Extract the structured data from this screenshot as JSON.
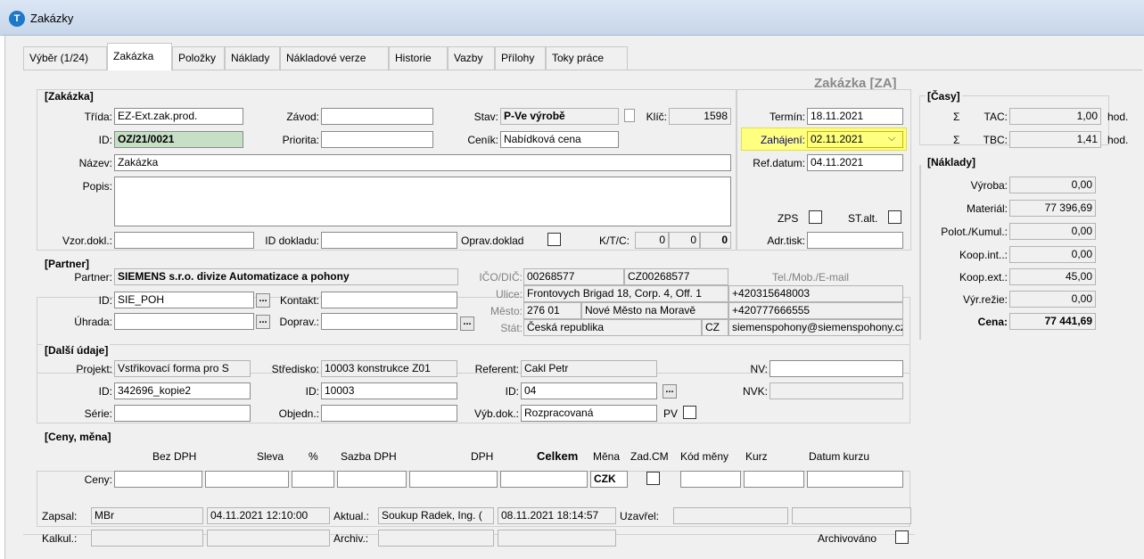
{
  "window": {
    "title": "Zakázky",
    "app_icon": "app-logo-icon"
  },
  "tabs": [
    {
      "label": "Výběr (1/24)"
    },
    {
      "label": "Zakázka"
    },
    {
      "label": "Položky"
    },
    {
      "label": "Náklady"
    },
    {
      "label": "Nákladové verze"
    },
    {
      "label": "Historie"
    },
    {
      "label": "Vazby"
    },
    {
      "label": "Přílohy"
    },
    {
      "label": "Toky práce"
    }
  ],
  "form_heading": "Zakázka [ZA]",
  "zakazka": {
    "group": "[Zakázka]",
    "trida_label": "Třída:",
    "trida": "EZ-Ext.zak.prod.",
    "zavod_label": "Závod:",
    "zavod": "",
    "stav_label": "Stav:",
    "stav": "P-Ve výrobě",
    "klic_label": "Klíč:",
    "klic": "1598",
    "id_label": "ID:",
    "id": "OZ/21/0021",
    "priorita_label": "Priorita:",
    "priorita": "",
    "cenik_label": "Ceník:",
    "cenik": "Nabídková cena",
    "nazev_label": "Název:",
    "nazev": "Zakázka",
    "popis_label": "Popis:",
    "popis": "",
    "vzor_label": "Vzor.dokl.:",
    "vzor": "",
    "iddokl_label": "ID dokladu:",
    "iddokl": "",
    "oprav_label": "Oprav.doklad",
    "ktc_label": "K/T/C:",
    "k": "0",
    "t": "0",
    "c": "0"
  },
  "terminy": {
    "termin_label": "Termín:",
    "termin": "18.11.2021",
    "zahajeni_label": "Zahájení:",
    "zahajeni": "02.11.2021",
    "refdatum_label": "Ref.datum:",
    "refdatum": "04.11.2021",
    "zps_label": "ZPS",
    "stalt_label": "ST.alt.",
    "adrtisk_label": "Adr.tisk:",
    "adrtisk": ""
  },
  "partner": {
    "group": "[Partner]",
    "partner_label": "Partner:",
    "partner": "SIEMENS s.r.o. divize Automatizace a pohony",
    "id_label": "ID:",
    "id": "SIE_POH",
    "kontakt_label": "Kontakt:",
    "kontakt": "",
    "uhrada_label": "Úhrada:",
    "uhrada": "",
    "doprav_label": "Doprav.:",
    "doprav": "",
    "ico_label": "IČO/DIČ:",
    "ico": "00268577",
    "dic": "CZ00268577",
    "ulice_label": "Ulice:",
    "ulice": "Frontovych Brigad 18, Corp. 4, Off. 1",
    "mesto_label": "Město:",
    "psc": "276 01",
    "mesto": "Nové Město na Moravě",
    "stat_label": "Stát:",
    "stat": "Česká republika",
    "stat_kod": "CZ",
    "tel_label": "Tel./Mob./E-mail",
    "tel": "+420315648003",
    "mob": "+420777666555",
    "email": "siemenspohony@siemenspohony.cz"
  },
  "dalsi": {
    "group": "[Další údaje]",
    "projekt_label": "Projekt:",
    "projekt": "Vstřikovací forma pro S",
    "stredisko_label": "Středisko:",
    "stredisko": "10003 konstrukce Z01",
    "referent_label": "Referent:",
    "referent": "Cakl Petr",
    "nv_label": "NV:",
    "nv": "",
    "id_label": "ID:",
    "projekt_id": "342696_kopie2",
    "stredisko_id": "10003",
    "referent_id": "04",
    "nvk_label": "NVK:",
    "nvk": "",
    "serie_label": "Série:",
    "serie": "",
    "objedn_label": "Objedn.:",
    "objedn": "",
    "vybdok_label": "Výb.dok.:",
    "vybdok": "Rozpracovaná",
    "pv_label": "PV"
  },
  "ceny": {
    "group": "[Ceny, měna]",
    "headers": {
      "bez_dph": "Bez DPH",
      "sleva": "Sleva",
      "pct": "%",
      "sazba": "Sazba DPH",
      "dph": "DPH",
      "celkem": "Celkem",
      "mena": "Měna",
      "zadcm": "Zad.CM",
      "kod": "Kód měny",
      "kurz": "Kurz",
      "datum": "Datum kurzu"
    },
    "row_label": "Ceny:",
    "mena": "CZK"
  },
  "casy": {
    "group": "[Časy]",
    "sigma": "Σ",
    "tac_label": "TAC:",
    "tac": "1,00",
    "tbc_label": "TBC:",
    "tbc": "1,41",
    "unit": "hod."
  },
  "naklady": {
    "group": "[Náklady]",
    "rows": [
      {
        "label": "Výroba:",
        "value": "0,00"
      },
      {
        "label": "Materiál:",
        "value": "77 396,69"
      },
      {
        "label": "Polot./Kumul.:",
        "value": "0,00"
      },
      {
        "label": "Koop.int..:",
        "value": "0,00"
      },
      {
        "label": "Koop.ext.:",
        "value": "45,00"
      },
      {
        "label": "Výr.režie:",
        "value": "0,00"
      }
    ],
    "cena_label": "Cena:",
    "cena": "77 441,69"
  },
  "audit": {
    "zapsal_label": "Zapsal:",
    "zapsal": "MBr",
    "zapsal_date": "04.11.2021 12:10:00",
    "aktual_label": "Aktual.:",
    "aktual": "Soukup Radek, Ing. (",
    "aktual_date": "08.11.2021 18:14:57",
    "uzavrel_label": "Uzavřel:",
    "kalkul_label": "Kalkul.:",
    "archiv_label": "Archiv.:",
    "archivovano_label": "Archivováno"
  },
  "colors": {
    "highlight": "#ffff80",
    "green_field": "#c6e0c6",
    "accent": "#1e78c8"
  }
}
